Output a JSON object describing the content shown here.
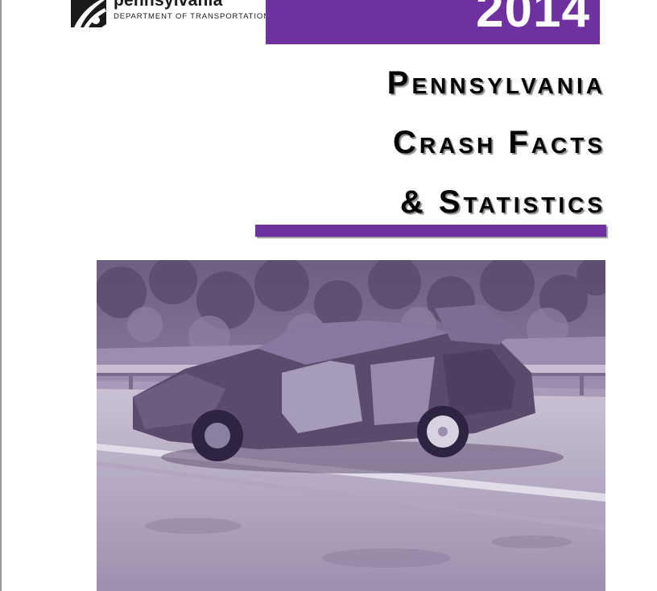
{
  "logo": {
    "wordmark": "pennsylvania",
    "department": "DEPARTMENT OF TRANSPORTATION"
  },
  "year": "2014",
  "title": {
    "line1": "Pennsylvania",
    "line2": "Crash Facts",
    "line3": "& Statistics"
  },
  "colors": {
    "accent": "#6f30a0",
    "photo_tint": "#a99bb7"
  },
  "photo": {
    "subject": "crash-photo"
  }
}
